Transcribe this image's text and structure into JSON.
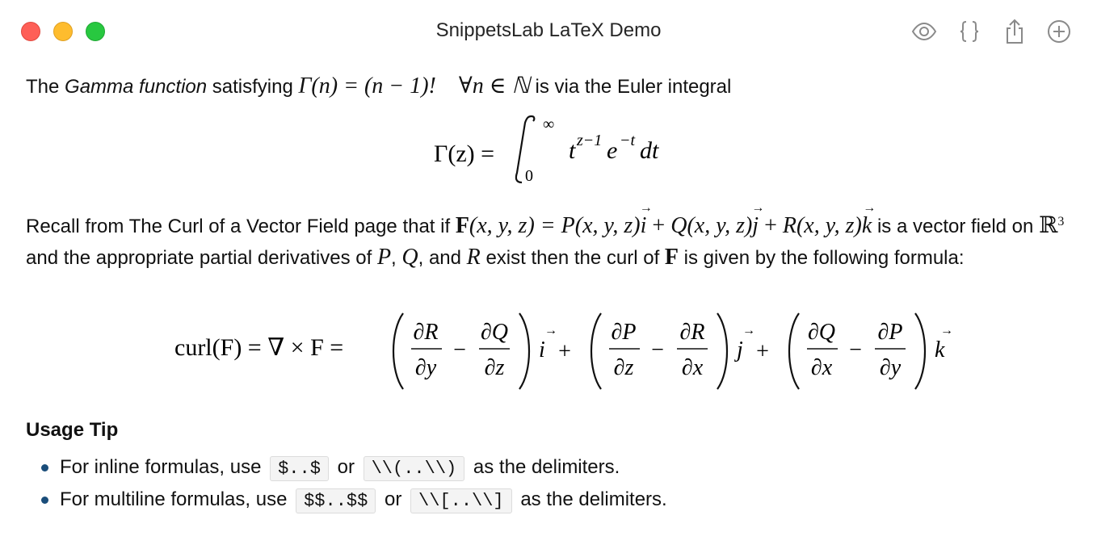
{
  "window": {
    "title": "SnippetsLab LaTeX Demo",
    "toolbar_icons": [
      "eye-icon",
      "braces-icon",
      "share-icon",
      "add-icon"
    ]
  },
  "paragraph1": {
    "t1": "The ",
    "t2": "Gamma function",
    "t3": " satisfying ",
    "math": "Γ(n) = (n − 1)!    ∀n ∈ ℕ",
    "t4": " is via the Euler integral"
  },
  "gamma_integral": {
    "lhs": "Γ(z) =",
    "upper": "∞",
    "lower": "0",
    "integrand": "t",
    "exp1": "z−1",
    "e": "e",
    "exp2": "−t",
    "dt": "dt"
  },
  "paragraph2": {
    "t1": "Recall from The Curl of a Vector Field page that if ",
    "F": "F",
    "args1": "(x, y, z) = ",
    "P": "P(x, y, z)",
    "i": "i",
    "plus1": " + ",
    "Q": "Q(x, y, z)",
    "j": "j",
    "plus2": " + ",
    "R": "R(x, y, z)",
    "k": "k",
    "t2": " is a vector field on ",
    "reals": "ℝ",
    "reals_exp": "3",
    "t3": " and the appropriate partial derivatives of ",
    "Pv": "P",
    "comma1": ", ",
    "Qv": "Q",
    "t4": ", and ",
    "Rv": "R",
    "t5": " exist then the curl of ",
    "F2": "F",
    "t6": " is given by the following formula:"
  },
  "curl_formula": {
    "lhs": "curl(F) = ∇ × F =",
    "terms": [
      {
        "num1": "∂R",
        "den1": "∂y",
        "num2": "∂Q",
        "den2": "∂z",
        "unit": "i",
        "plus": "+"
      },
      {
        "num1": "∂P",
        "den1": "∂z",
        "num2": "∂R",
        "den2": "∂x",
        "unit": "j",
        "plus": "+"
      },
      {
        "num1": "∂Q",
        "den1": "∂x",
        "num2": "∂P",
        "den2": "∂y",
        "unit": "k",
        "plus": ""
      }
    ]
  },
  "usage_tip": {
    "title": "Usage Tip",
    "items": [
      {
        "pre": "For inline formulas, use",
        "code1": "$..$",
        "mid": "or",
        "code2": "\\\\(..\\\\)",
        "post": "as the delimiters."
      },
      {
        "pre": "For multiline formulas, use",
        "code1": "$$..$$",
        "mid": "or",
        "code2": "\\\\[..\\\\]",
        "post": "as the delimiters."
      }
    ]
  }
}
